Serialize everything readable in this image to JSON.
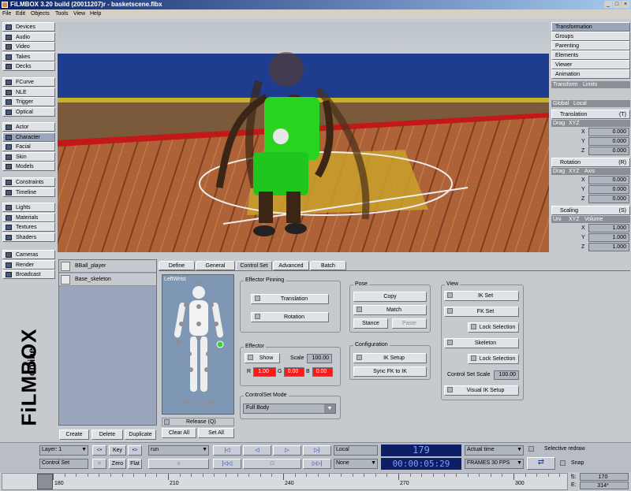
{
  "window": {
    "title": "FiLMBOX 3.20 build (20011207)r - basketscene.flbx"
  },
  "menu": [
    "File",
    "Edit",
    "Objects",
    "Tools",
    "View",
    "Help"
  ],
  "left_nav": {
    "group1": [
      "Devices",
      "Audio",
      "Video",
      "Takes",
      "Decks"
    ],
    "group2": [
      "FCurve",
      "NLE",
      "Trigger",
      "Optical"
    ],
    "group3": [
      "Actor",
      "Character",
      "Facial",
      "Skin",
      "Models"
    ],
    "group4": [
      "Constraints",
      "Timeline"
    ],
    "group5": [
      "Lights",
      "Materials",
      "Textures",
      "Shaders"
    ],
    "group6": [
      "Cameras",
      "Render",
      "Broadcast"
    ],
    "selected": "Character"
  },
  "right_panel": {
    "tabs": [
      "Transformation",
      "Groups",
      "Parenting",
      "Elements",
      "Viewer",
      "Animation"
    ],
    "subtabs": [
      "Transform",
      "Limits"
    ],
    "space_tabs": [
      "Global",
      "Local"
    ],
    "translation": {
      "label": "Translation",
      "shortcut": "(T)",
      "modes": [
        "Drag",
        "XYZ"
      ],
      "x": "0.000",
      "y": "0.000",
      "z": "0.000"
    },
    "rotation": {
      "label": "Rotation",
      "shortcut": "(R)",
      "modes": [
        "Drag",
        "XYZ",
        "Axis"
      ],
      "x": "0.000",
      "y": "0.000",
      "z": "0.000"
    },
    "scaling": {
      "label": "Scaling",
      "shortcut": "(S)",
      "modes": [
        "Uni",
        "XYZ",
        "Volume"
      ],
      "x": "1.000",
      "y": "1.000",
      "z": "1.000"
    },
    "axis_labels": [
      "X",
      "Y",
      "Z"
    ]
  },
  "character_list": {
    "items": [
      "BBall_player",
      "Base_skeleton"
    ],
    "buttons": [
      "Create",
      "Delete",
      "Duplicate"
    ]
  },
  "tabs": [
    "Define",
    "General",
    "Control Set",
    "Advanced",
    "Batch"
  ],
  "active_tab": "Control Set",
  "figure": {
    "label": "LeftWrist",
    "release": "Release (Q)",
    "clear_all": "Clear All",
    "set_all": "Set All"
  },
  "effector_pinning": {
    "title": "Effector Pinning",
    "translation": "Translation",
    "rotation": "Rotation"
  },
  "effector": {
    "title": "Effector",
    "show": "Show",
    "scale_label": "Scale",
    "scale": "100.00",
    "r_label": "R",
    "r": "1.00",
    "g_label": "G",
    "g": "0.00",
    "b_label": "B",
    "b": "0.00"
  },
  "controlset_mode": {
    "title": "ControlSet Mode",
    "value": "Full Body"
  },
  "pose": {
    "title": "Pose",
    "copy": "Copy",
    "match": "Match",
    "stance": "Stance",
    "paste": "Paste"
  },
  "configuration": {
    "title": "Configuration",
    "ik_setup": "IK Setup",
    "sync": "Sync FK to IK"
  },
  "view": {
    "title": "View",
    "ik_set": "IK Set",
    "fk_set": "FK Set",
    "lock_selection": "Lock Selection",
    "skeleton": "Skeleton",
    "lock_selection2": "Lock Selection",
    "scale_label": "Control Set Scale",
    "scale": "100.00",
    "visual_ik": "Visual IK Setup"
  },
  "logo": {
    "brand": "FiLMBOX",
    "sub": "online"
  },
  "transport": {
    "layer": "Layer: 1",
    "control_set": "Control Set",
    "key": "Key",
    "zero": "Zero",
    "flat": "Flat",
    "take": "run",
    "local": "Local",
    "none": "None",
    "frame": "179",
    "timecode": "00:00:05:29",
    "actual_time": "Actual time",
    "fps": "FRAMES 30 FPS",
    "selective_redraw": "Selective redraw",
    "snap": "Snap",
    "start_label": "S:",
    "start": "170",
    "end_label": "E:",
    "end": "314*"
  },
  "timeline": {
    "ticks": [
      "180",
      "210",
      "240",
      "270",
      "300"
    ]
  },
  "colors": {
    "title_bar": "#0a246a",
    "viewport_floor": "#a95e38",
    "jersey": "#29d420",
    "selection": "#9ba6bd"
  }
}
